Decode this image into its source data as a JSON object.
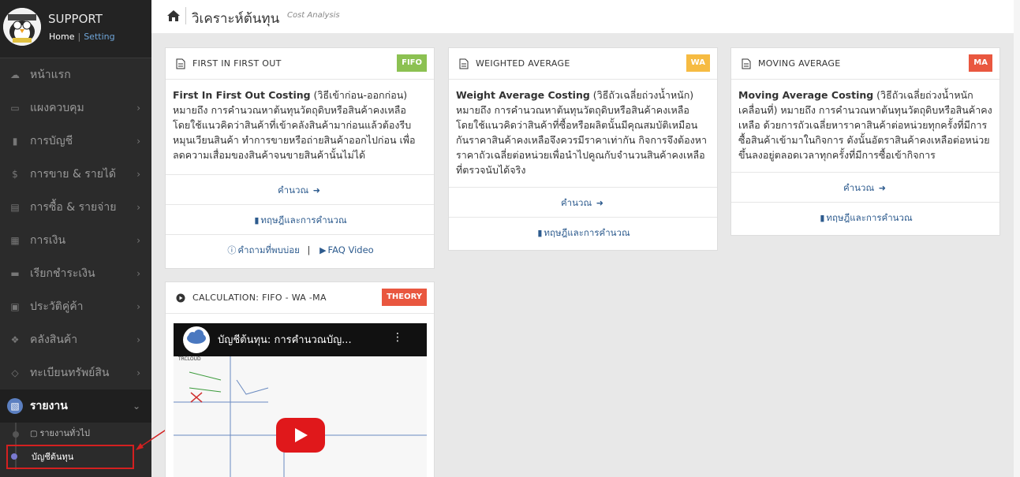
{
  "sidebar": {
    "brand_title": "SUPPORT",
    "home_link": "Home",
    "sep": "|",
    "setting_link": "Setting",
    "items": [
      {
        "label": "หน้าแรก",
        "icon": "cloud-icon",
        "chevron": false
      },
      {
        "label": "แผงควบคุม",
        "icon": "monitor-icon",
        "chevron": true
      },
      {
        "label": "การบัญชี",
        "icon": "book-icon",
        "chevron": true
      },
      {
        "label": "การขาย & รายได้",
        "icon": "dollar-icon",
        "chevron": true
      },
      {
        "label": "การซื้อ & รายจ่าย",
        "icon": "cart-icon",
        "chevron": true
      },
      {
        "label": "การเงิน",
        "icon": "calendar-icon",
        "chevron": true
      },
      {
        "label": "เรียกชำระเงิน",
        "icon": "credit-card-icon",
        "chevron": true
      },
      {
        "label": "ประวัติคู่ค้า",
        "icon": "contact-icon",
        "chevron": true
      },
      {
        "label": "คลังสินค้า",
        "icon": "cubes-icon",
        "chevron": true
      },
      {
        "label": "ทะเบียนทรัพย์สิน",
        "icon": "diamond-icon",
        "chevron": true
      },
      {
        "label": "รายงาน",
        "icon": "report-icon",
        "chevron": true
      }
    ],
    "sub_items": [
      {
        "label": "รายงานทั่วไป"
      },
      {
        "label": "บัญชีต้นทุน"
      }
    ]
  },
  "header": {
    "title": "วิเคราะห์ต้นทุน",
    "subtitle": "Cost Analysis"
  },
  "cards": {
    "fifo": {
      "title": "FIRST IN FIRST OUT",
      "badge": "FIFO",
      "badge_color": "#8cc152",
      "lead": "First In First Out Costing",
      "text": " (วิธีเข้าก่อน-ออกก่อน) หมายถึง การคำนวณหาต้นทุนวัตถุดิบหรือสินค้าคงเหลือ โดยใช้แนวคิดว่าสินค้าที่เข้าคลังสินค้ามาก่อนแล้วต้องรีบหมุนเวียนสินค้า ทำการขายหรือถ่ายสินค้าออกไปก่อน เพื่อลดความเสื่อมของสินค้าจนขายสินค้านั้นไม่ได้",
      "calc": "คำนวณ",
      "theory": "ทฤษฎีและการคำนวณ",
      "faq": "คำถามที่พบบ่อย",
      "faq_sep": "|",
      "video": "FAQ Video"
    },
    "wa": {
      "title": "WEIGHTED AVERAGE",
      "badge": "WA",
      "badge_color": "#f6bb42",
      "lead": "Weight Average Costing",
      "text": " (วิธีถัวเฉลี่ยถ่วงน้ำหนัก) หมายถึง การคำนวณหาต้นทุนวัตถุดิบหรือสินค้าคงเหลือ โดยใช้แนวคิดว่าสินค้าที่ซื้อหรือผลิตนั้นมีคุณสมบัติเหมือนกันราคาสินค้าคงเหลือจึงควรมีราคาเท่ากัน กิจการจึงต้องหาราคาถัวเฉลี่ยต่อหน่วยเพื่อนำไปคูณกับจำนวนสินค้าคงเหลือที่ตรวจนับได้จริง",
      "calc": "คำนวณ",
      "theory": "ทฤษฎีและการคำนวณ"
    },
    "ma": {
      "title": "MOVING AVERAGE",
      "badge": "MA",
      "badge_color": "#e9573f",
      "lead": "Moving Average Costing",
      "text": " (วิธีถัวเฉลี่ยถ่วงน้ำหนักเคลื่อนที่) หมายถึง การคำนวณหาต้นทุนวัตถุดิบหรือสินค้าคงเหลือ ด้วยการถัวเฉลี่ยหาราคาสินค้าต่อหน่วยทุกครั้งที่มีการซื้อสินค้าเข้ามาในกิจการ ดังนั้นอัตราสินค้าคงเหลือต่อหน่วยขึ้นลงอยู่ตลอดเวลาทุกครั้งที่มีการซื้อเข้ากิจการ",
      "calc": "คำนวณ",
      "theory": "ทฤษฎีและการคำนวณ"
    },
    "calc_video": {
      "title": "CALCULATION: FIFO - WA -MA",
      "badge": "THEORY",
      "badge_color": "#e9573f",
      "video_title": "บัญชีต้นทุน: การคำนวณบัญ...",
      "channel": "TRCLOUD"
    }
  }
}
